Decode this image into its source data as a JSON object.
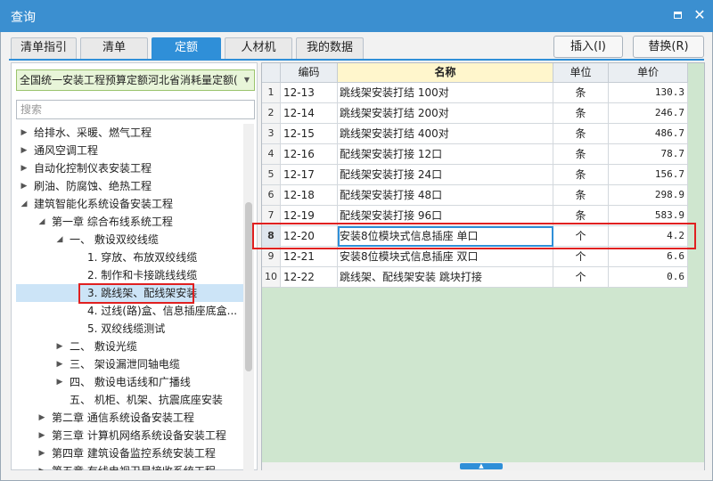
{
  "window": {
    "title": "查询"
  },
  "tabs": [
    {
      "label": "清单指引",
      "active": false
    },
    {
      "label": "清单",
      "active": false
    },
    {
      "label": "定额",
      "active": true
    },
    {
      "label": "人材机",
      "active": false
    },
    {
      "label": "我的数据",
      "active": false
    }
  ],
  "toolbar": {
    "insert_label": "插入(I)",
    "replace_label": "替换(R)"
  },
  "left": {
    "library_value": "全国统一安装工程预算定额河北省消耗量定额(",
    "search_placeholder": "搜索",
    "tree": [
      {
        "label": "给排水、采暖、燃气工程",
        "level": 0,
        "expander": "collapsed"
      },
      {
        "label": "通风空调工程",
        "level": 0,
        "expander": "collapsed"
      },
      {
        "label": "自动化控制仪表安装工程",
        "level": 0,
        "expander": "collapsed"
      },
      {
        "label": "刷油、防腐蚀、绝热工程",
        "level": 0,
        "expander": "collapsed"
      },
      {
        "label": "建筑智能化系统设备安装工程",
        "level": 0,
        "expander": "expanded"
      },
      {
        "label": "第一章 综合布线系统工程",
        "level": 1,
        "expander": "expanded"
      },
      {
        "label": "一、 敷设双绞线缆",
        "level": 2,
        "expander": "expanded"
      },
      {
        "label": "1. 穿放、布放双绞线缆",
        "level": 3,
        "expander": "none"
      },
      {
        "label": "2. 制作和卡接跳线线缆",
        "level": 3,
        "expander": "none"
      },
      {
        "label": "3. 跳线架、配线架安装",
        "level": 3,
        "expander": "none",
        "selected": true
      },
      {
        "label": "4. 过线(路)盒、信息插座底盒...",
        "level": 3,
        "expander": "none"
      },
      {
        "label": "5. 双绞线缆测试",
        "level": 3,
        "expander": "none"
      },
      {
        "label": "二、 敷设光缆",
        "level": 2,
        "expander": "collapsed"
      },
      {
        "label": "三、 架设漏泄同轴电缆",
        "level": 2,
        "expander": "collapsed"
      },
      {
        "label": "四、 敷设电话线和广播线",
        "level": 2,
        "expander": "collapsed"
      },
      {
        "label": "五、 机柜、机架、抗震底座安装",
        "level": 2,
        "expander": "none"
      },
      {
        "label": "第二章 通信系统设备安装工程",
        "level": 1,
        "expander": "collapsed"
      },
      {
        "label": "第三章 计算机网络系统设备安装工程",
        "level": 1,
        "expander": "collapsed"
      },
      {
        "label": "第四章 建筑设备监控系统安装工程",
        "level": 1,
        "expander": "collapsed"
      },
      {
        "label": "第五章 有线电视卫星接收系统工程",
        "level": 1,
        "expander": "collapsed"
      }
    ]
  },
  "grid": {
    "columns": [
      "",
      "编码",
      "名称",
      "单位",
      "单价"
    ],
    "rows": [
      {
        "num": "1",
        "code": "12-13",
        "name": "跳线架安装打结 100对",
        "unit": "条",
        "price": "130.3"
      },
      {
        "num": "2",
        "code": "12-14",
        "name": "跳线架安装打结 200对",
        "unit": "条",
        "price": "246.7"
      },
      {
        "num": "3",
        "code": "12-15",
        "name": "跳线架安装打结 400对",
        "unit": "条",
        "price": "486.7"
      },
      {
        "num": "4",
        "code": "12-16",
        "name": "配线架安装打接 12口",
        "unit": "条",
        "price": "78.7"
      },
      {
        "num": "5",
        "code": "12-17",
        "name": "配线架安装打接 24口",
        "unit": "条",
        "price": "156.7"
      },
      {
        "num": "6",
        "code": "12-18",
        "name": "配线架安装打接 48口",
        "unit": "条",
        "price": "298.9"
      },
      {
        "num": "7",
        "code": "12-19",
        "name": "配线架安装打接 96口",
        "unit": "条",
        "price": "583.9"
      },
      {
        "num": "8",
        "code": "12-20",
        "name": "安装8位模块式信息插座 单口",
        "unit": "个",
        "price": "4.2",
        "current": true
      },
      {
        "num": "9",
        "code": "12-21",
        "name": "安装8位模块式信息插座 双口",
        "unit": "个",
        "price": "6.6"
      },
      {
        "num": "10",
        "code": "12-22",
        "name": "跳线架、配线架安装 跳块打接",
        "unit": "个",
        "price": "0.6"
      }
    ]
  },
  "colors": {
    "title_bar": "#3b8fd0",
    "tab_active": "#2f8fd8",
    "grid_empty": "#cfe6cf",
    "highlight_box": "#e02020"
  }
}
